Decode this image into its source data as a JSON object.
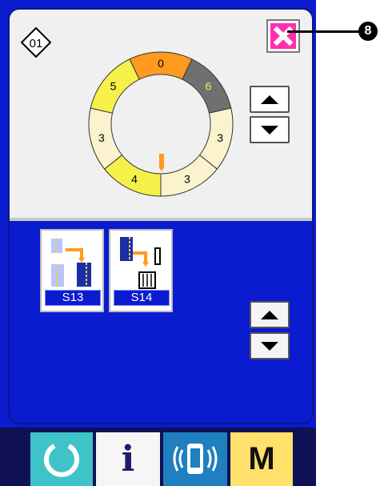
{
  "colors": {
    "screen_bg": "#0a1bd0",
    "panel_top": "#f0f0f0",
    "seg_orange": "#ff9a1f",
    "seg_yellow": "#f6f14a",
    "seg_dark": "#707070",
    "seg_beige": "#fbf3cd",
    "close_btn": "#ff2fb0"
  },
  "pattern": {
    "icon": "pattern-number-icon",
    "number": "01"
  },
  "close": {
    "icon": "close-x-icon"
  },
  "callout": {
    "number": "8"
  },
  "ring": {
    "segments": [
      {
        "label": "0",
        "fill": "orange"
      },
      {
        "label": "6",
        "fill": "dark"
      },
      {
        "label": "3",
        "fill": "beige"
      },
      {
        "label": "3",
        "fill": "beige"
      },
      {
        "label": "4",
        "fill": "yellow"
      },
      {
        "label": "3",
        "fill": "beige"
      },
      {
        "label": "5",
        "fill": "yellow"
      }
    ]
  },
  "steps": [
    {
      "label": "S13",
      "icon": "cloth-transfer-icon"
    },
    {
      "label": "S14",
      "icon": "cloth-stacker-icon"
    }
  ],
  "footer": {
    "reset_icon": "reset-circle-icon",
    "info_label": "i",
    "comm_icon": "communication-icon",
    "mode_label": "M"
  }
}
